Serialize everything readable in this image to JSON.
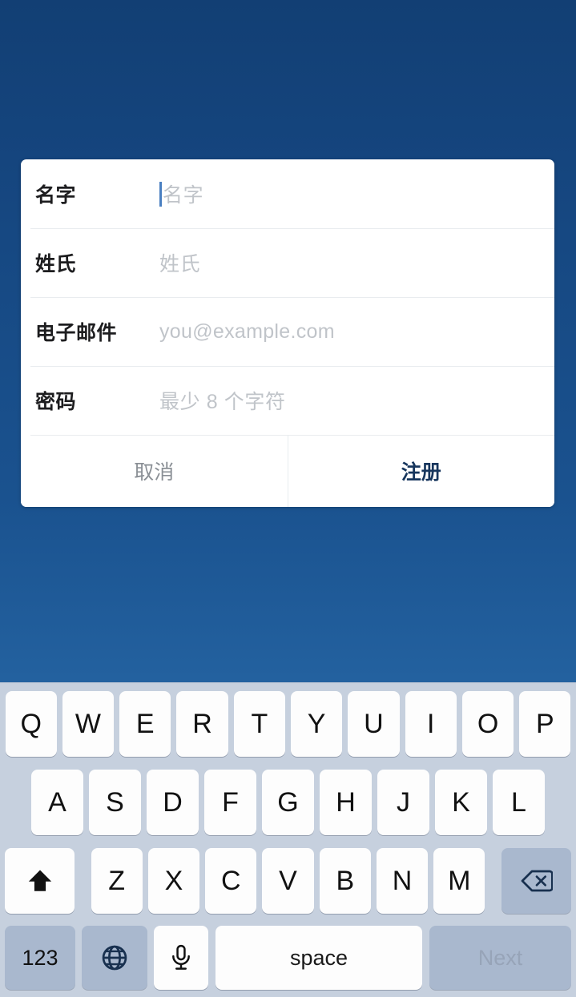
{
  "theme": {
    "background_top": "#123f74",
    "background_bottom": "#24629f",
    "dialog_background": "#ffffff",
    "keyboard_background": "#c6d0de",
    "key_background": "#fdfdfd",
    "key_gray_background": "#a9b8ce",
    "accent": "#17365d",
    "caret_color": "#4a7fc1",
    "placeholder_color": "#c0c4c9"
  },
  "dialog": {
    "fields": [
      {
        "label": "名字",
        "placeholder": "名字",
        "value": "",
        "focused": true,
        "name": "first-name"
      },
      {
        "label": "姓氏",
        "placeholder": "姓氏",
        "value": "",
        "focused": false,
        "name": "last-name"
      },
      {
        "label": "电子邮件",
        "placeholder": "you@example.com",
        "value": "",
        "focused": false,
        "name": "email"
      },
      {
        "label": "密码",
        "placeholder": "最少 8 个字符",
        "value": "",
        "focused": false,
        "name": "password"
      }
    ],
    "cancel_label": "取消",
    "submit_label": "注册"
  },
  "keyboard": {
    "layout": "qwerty-uppercase",
    "row1": [
      "Q",
      "W",
      "E",
      "R",
      "T",
      "Y",
      "U",
      "I",
      "O",
      "P"
    ],
    "row2": [
      "A",
      "S",
      "D",
      "F",
      "G",
      "H",
      "J",
      "K",
      "L"
    ],
    "row3": [
      "Z",
      "X",
      "C",
      "V",
      "B",
      "N",
      "M"
    ],
    "shift_icon": "shift-arrow-up-icon",
    "delete_icon": "backspace-delete-icon",
    "numbers_label": "123",
    "globe_icon": "globe-language-icon",
    "mic_icon": "microphone-icon",
    "space_label": "space",
    "return_label": "Next"
  }
}
